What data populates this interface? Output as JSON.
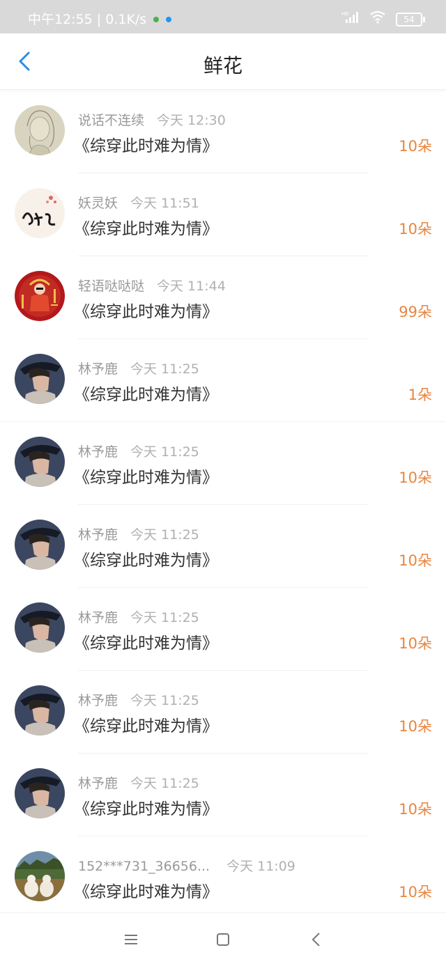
{
  "status_bar": {
    "time_speed": "中午12:55 | 0.1K/s",
    "network": "HD",
    "battery": "54"
  },
  "header": {
    "back_icon": "chevron-left-icon",
    "title": "鲜花"
  },
  "rows": [
    {
      "name": "说话不连续",
      "time": "今天 12:30",
      "book": "《综穿此时难为情》",
      "amount": "10朵",
      "avatar": "sketch-girl"
    },
    {
      "name": "妖灵妖",
      "time": "今天 11:51",
      "book": "《综穿此时难为情》",
      "amount": "10朵",
      "avatar": "calligraphy"
    },
    {
      "name": "轻语哒哒哒",
      "time": "今天 11:44",
      "book": "《综穿此时难为情》",
      "amount": "99朵",
      "avatar": "red-poster"
    },
    {
      "name": "林予鹿",
      "time": "今天 11:25",
      "book": "《综穿此时难为情》",
      "amount": "1朵",
      "avatar": "hat-boy"
    },
    {
      "name": "林予鹿",
      "time": "今天 11:25",
      "book": "《综穿此时难为情》",
      "amount": "10朵",
      "avatar": "hat-boy"
    },
    {
      "name": "林予鹿",
      "time": "今天 11:25",
      "book": "《综穿此时难为情》",
      "amount": "10朵",
      "avatar": "hat-boy"
    },
    {
      "name": "林予鹿",
      "time": "今天 11:25",
      "book": "《综穿此时难为情》",
      "amount": "10朵",
      "avatar": "hat-boy"
    },
    {
      "name": "林予鹿",
      "time": "今天 11:25",
      "book": "《综穿此时难为情》",
      "amount": "10朵",
      "avatar": "hat-boy"
    },
    {
      "name": "林予鹿",
      "time": "今天 11:25",
      "book": "《综穿此时难为情》",
      "amount": "10朵",
      "avatar": "hat-boy"
    },
    {
      "name": "152***731_36656...",
      "time": "今天 11:09",
      "book": "《综穿此时难为情》",
      "amount": "10朵",
      "avatar": "dogs-field"
    }
  ],
  "navbar": {
    "menu_icon": "menu-icon",
    "home_icon": "home-square-icon",
    "back_icon": "back-triangle-icon"
  },
  "colors": {
    "accent_blue": "#2a8ce8",
    "amount_orange": "#e8853f",
    "status_bar_bg": "#d9d9d9"
  }
}
